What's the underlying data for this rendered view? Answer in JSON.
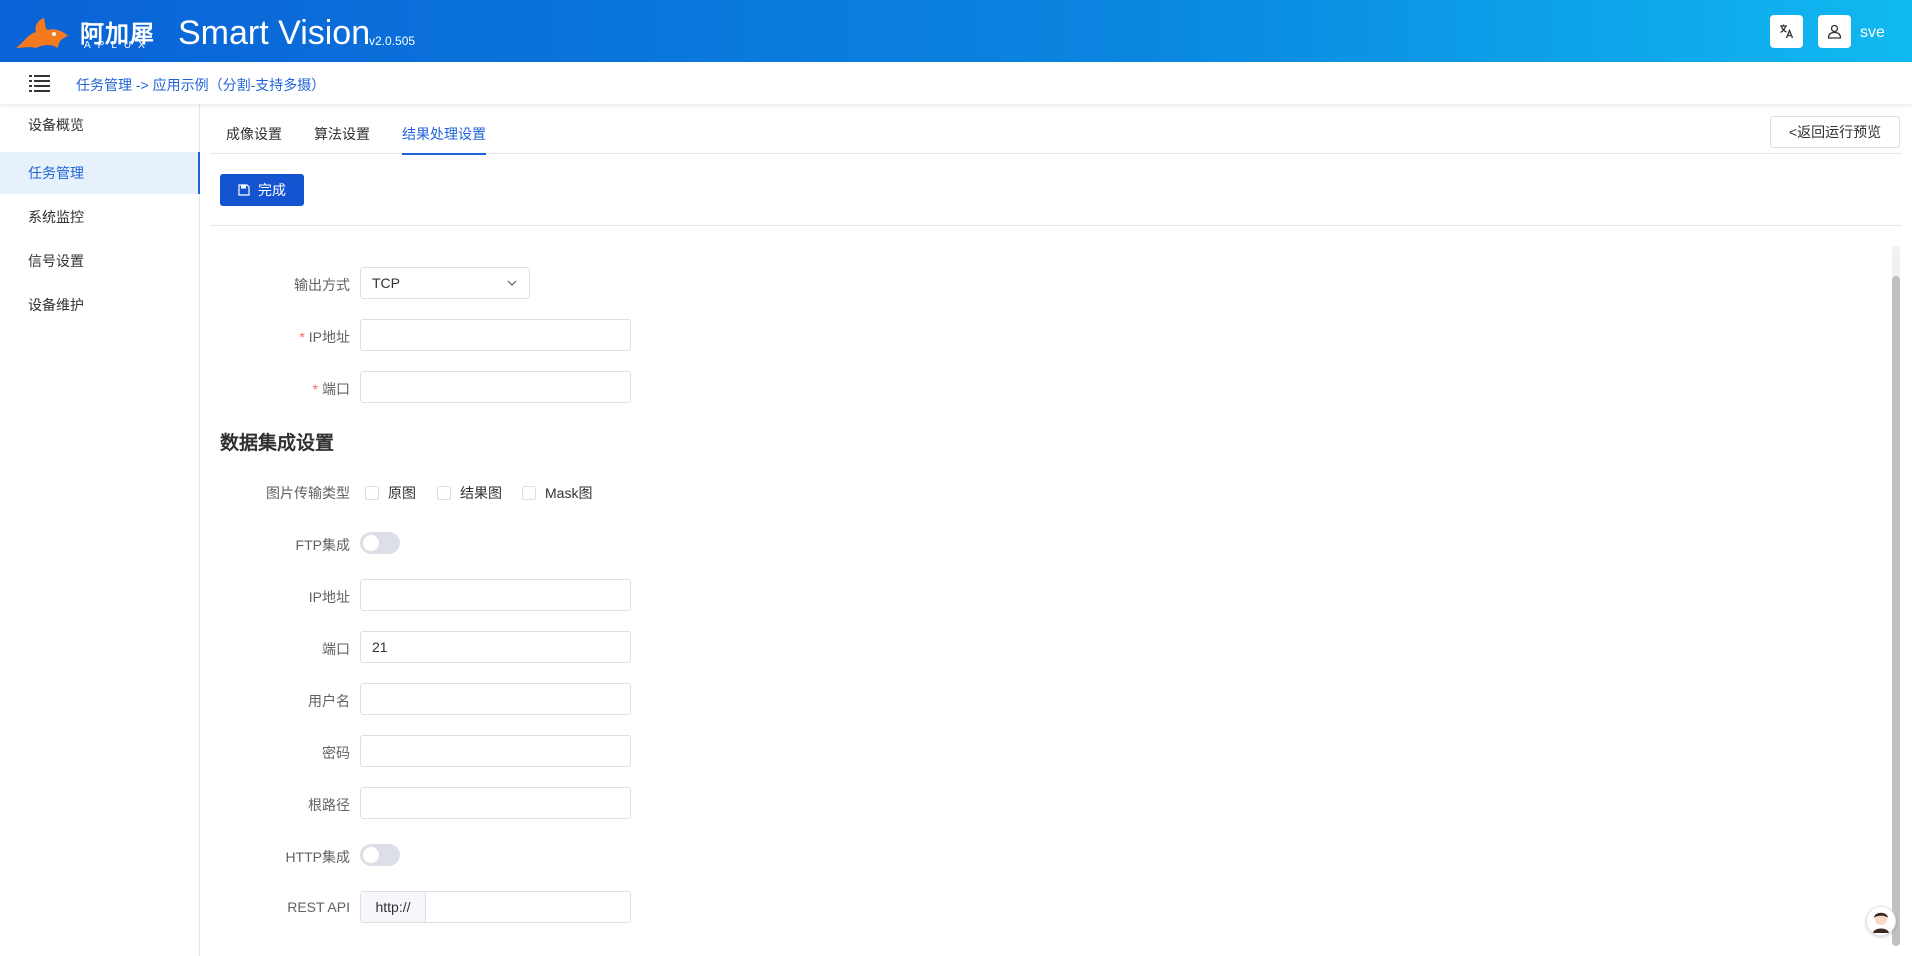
{
  "header": {
    "logo_cn": "阿加犀",
    "logo_en": "APLUX",
    "app_title": "Smart Vision",
    "version": "v2.0.505",
    "username": "sve",
    "accent": "#0a62d6"
  },
  "breadcrumb": {
    "text": "任务管理 -> 应用示例（分割-支持多摄）"
  },
  "sidebar": {
    "items": [
      {
        "label": "设备概览"
      },
      {
        "label": "任务管理"
      },
      {
        "label": "系统监控"
      },
      {
        "label": "信号设置"
      },
      {
        "label": "设备维护"
      }
    ],
    "active_index": 1
  },
  "tabs": {
    "items": [
      {
        "label": "成像设置"
      },
      {
        "label": "算法设置"
      },
      {
        "label": "结果处理设置"
      }
    ],
    "active_index": 2
  },
  "toolbar": {
    "back_label": "<返回运行预览",
    "done_label": "完成"
  },
  "output": {
    "method_label": "输出方式",
    "method_value": "TCP",
    "ip_label": "IP地址",
    "ip_value": "",
    "port_label": "端口",
    "port_value": ""
  },
  "data_integration": {
    "title": "数据集成设置",
    "image_type_label": "图片传输类型",
    "image_types": [
      {
        "label": "原图",
        "checked": false
      },
      {
        "label": "结果图",
        "checked": false
      },
      {
        "label": "Mask图",
        "checked": false
      }
    ],
    "ftp_label": "FTP集成",
    "ftp_enabled": false,
    "ftp_ip_label": "IP地址",
    "ftp_ip_value": "",
    "ftp_port_label": "端口",
    "ftp_port_value": "21",
    "username_label": "用户名",
    "username_value": "",
    "password_label": "密码",
    "password_value": "",
    "root_path_label": "根路径",
    "root_path_value": "",
    "http_label": "HTTP集成",
    "http_enabled": false,
    "rest_api_label": "REST API",
    "rest_api_prefix": "http://",
    "rest_api_value": ""
  }
}
